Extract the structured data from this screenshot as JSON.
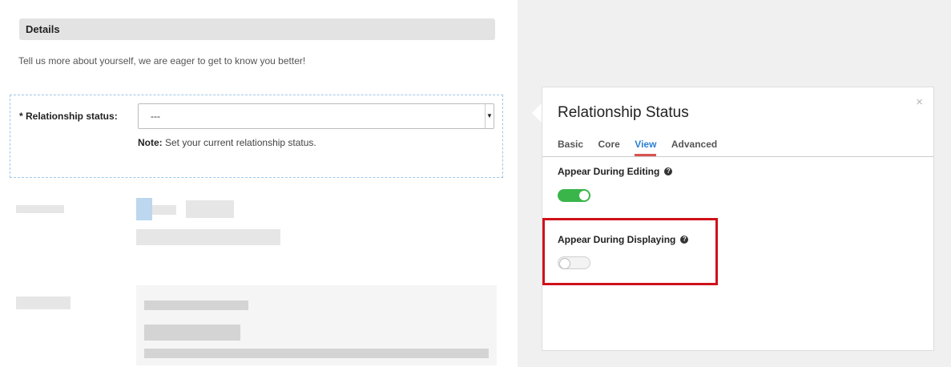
{
  "form": {
    "section_title": "Details",
    "intro": "Tell us more about yourself, we are eager to get to know you better!",
    "field_label": "* Relationship status:",
    "select_value": "---",
    "note_label": "Note:",
    "note_text": " Set your current relationship status."
  },
  "panel": {
    "title": "Relationship Status",
    "close": "×",
    "tabs": [
      "Basic",
      "Core",
      "View",
      "Advanced"
    ],
    "active_tab": "View",
    "options": [
      {
        "label": "Appear During Editing",
        "enabled": true
      },
      {
        "label": "Appear During Displaying",
        "enabled": false
      }
    ],
    "help_glyph": "?"
  },
  "colors": {
    "toggle_on": "#3ab54a",
    "active_tab": "#2a7fd2",
    "tab_underline": "#d9534f",
    "highlight": "#d0111b"
  },
  "icons": {
    "close": "close-icon",
    "help": "help-icon",
    "caret": "chevron-down-icon"
  }
}
